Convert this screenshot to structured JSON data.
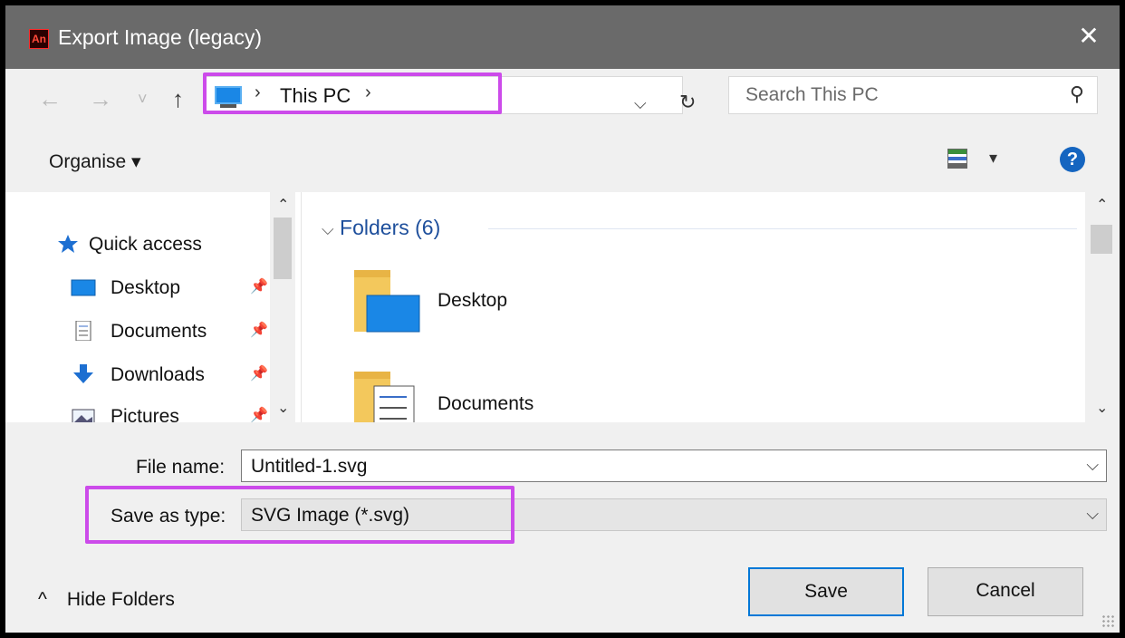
{
  "window": {
    "title": "Export Image (legacy)",
    "app_logo": "An",
    "close_glyph": "✕"
  },
  "nav": {
    "back_glyph": "←",
    "forward_glyph": "→",
    "recent_glyph": "˅",
    "up_glyph": "↑",
    "address_separator": "›",
    "address_current": "This PC",
    "address_trailing": "›",
    "dropdown_glyph": "⌵",
    "refresh_glyph": "↻",
    "search_placeholder": "Search This PC",
    "search_glyph": "⚲"
  },
  "toolbar": {
    "organise_label": "Organise ▾",
    "view_dropdown_glyph": "▾",
    "help_glyph": "?"
  },
  "sidebar": {
    "quick_access_label": "Quick access",
    "items": [
      {
        "label": "Desktop",
        "icon": "desktop-icon"
      },
      {
        "label": "Documents",
        "icon": "documents-icon"
      },
      {
        "label": "Downloads",
        "icon": "downloads-icon"
      },
      {
        "label": "Pictures",
        "icon": "pictures-icon"
      }
    ],
    "pin_glyph": "📌"
  },
  "main": {
    "group_title": "Folders (6)",
    "group_chevron": "⌵",
    "folders": [
      {
        "label": "Desktop",
        "icon": "desktop-folder-icon"
      },
      {
        "label": "Documents",
        "icon": "documents-folder-icon"
      }
    ]
  },
  "form": {
    "file_name_label": "File name:",
    "file_name_value": "Untitled-1.svg",
    "save_type_label": "Save as type:",
    "save_type_value": "SVG Image (*.svg)",
    "combo_arrow": "⌵"
  },
  "buttons": {
    "save": "Save",
    "cancel": "Cancel",
    "hide_folders": "Hide Folders",
    "hide_folders_glyph": "^"
  },
  "colors": {
    "titlebar": "#6a6a6a",
    "highlight": "#cc4bea",
    "accent": "#0078d7",
    "folder_heading": "#1e4f9c"
  }
}
